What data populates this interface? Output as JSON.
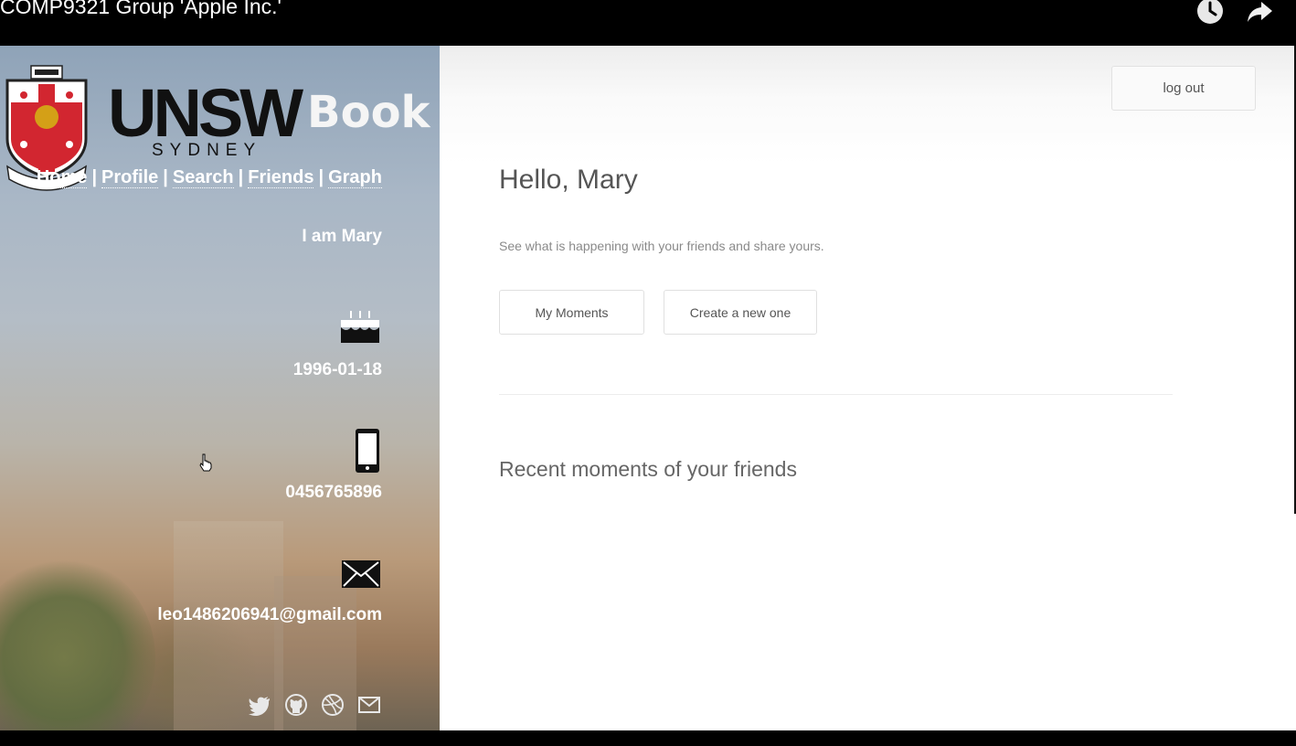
{
  "player": {
    "title": "COMP9321 Group 'Apple Inc.'",
    "icons": [
      "clock-icon",
      "share-icon"
    ]
  },
  "brand": {
    "unsw": "UNSW",
    "book": "Book",
    "sydney": "SYDNEY",
    "crest_motto": "MANU ET MENTE",
    "crest_banner": "SCIENTIA"
  },
  "nav": {
    "items": [
      {
        "label": "Home"
      },
      {
        "label": "Profile"
      },
      {
        "label": "Search"
      },
      {
        "label": "Friends"
      },
      {
        "label": "Graph"
      }
    ],
    "separator": "|"
  },
  "profile": {
    "greeting": "I am Mary",
    "birthday": "1996-01-18",
    "phone": "0456765896",
    "email": "leo1486206941@gmail.com",
    "icons": [
      "birthday-cake-icon",
      "phone-icon",
      "envelope-icon"
    ]
  },
  "social": {
    "icons": [
      "twitter-icon",
      "github-icon",
      "dribbble-icon",
      "mail-icon"
    ]
  },
  "main": {
    "logout_label": "log out",
    "hello": "Hello, Mary",
    "subtitle": "See what is happening with your friends and share yours.",
    "my_moments_label": "My Moments",
    "create_label": "Create a new one",
    "recent_heading": "Recent moments of your friends"
  },
  "colors": {
    "sidebar_top": "#8fa3b8",
    "sidebar_bottom": "#6d6353",
    "crest_red": "#d22630",
    "text_main": "#555555"
  }
}
